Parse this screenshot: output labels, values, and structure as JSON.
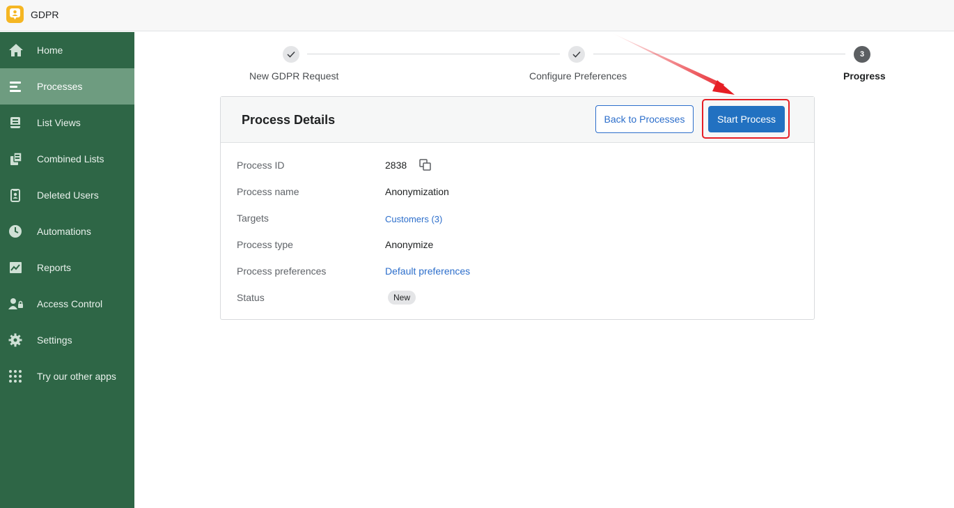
{
  "app": {
    "title": "GDPR"
  },
  "sidebar": {
    "items": [
      {
        "label": "Home",
        "icon": "home-icon"
      },
      {
        "label": "Processes",
        "icon": "processes-icon",
        "active": true
      },
      {
        "label": "List Views",
        "icon": "list-views-icon"
      },
      {
        "label": "Combined Lists",
        "icon": "combined-lists-icon"
      },
      {
        "label": "Deleted Users",
        "icon": "deleted-users-icon"
      },
      {
        "label": "Automations",
        "icon": "clock-icon"
      },
      {
        "label": "Reports",
        "icon": "reports-icon"
      },
      {
        "label": "Access Control",
        "icon": "access-control-icon"
      },
      {
        "label": "Settings",
        "icon": "gear-icon"
      },
      {
        "label": "Try our other apps",
        "icon": "apps-grid-icon"
      }
    ]
  },
  "stepper": {
    "steps": [
      {
        "label": "New GDPR Request",
        "state": "done"
      },
      {
        "label": "Configure Preferences",
        "state": "done"
      },
      {
        "label": "Progress",
        "number": "3",
        "state": "current"
      }
    ]
  },
  "card": {
    "title": "Process Details",
    "back_button": "Back to Processes",
    "start_button": "Start Process",
    "rows": [
      {
        "label": "Process ID",
        "value": "2838"
      },
      {
        "label": "Process name",
        "value": "Anonymization"
      },
      {
        "label": "Targets",
        "value": "Customers (3)"
      },
      {
        "label": "Process type",
        "value": "Anonymize"
      },
      {
        "label": "Process preferences",
        "value": "Default preferences"
      },
      {
        "label": "Status",
        "value": "New"
      }
    ]
  },
  "colors": {
    "sidebar": "#2e6646",
    "sidebar_active": "#6e9c80",
    "primary": "#2271c1",
    "link": "#2c6ecb",
    "annotation": "#e61e25",
    "logo": "#f5b623"
  }
}
